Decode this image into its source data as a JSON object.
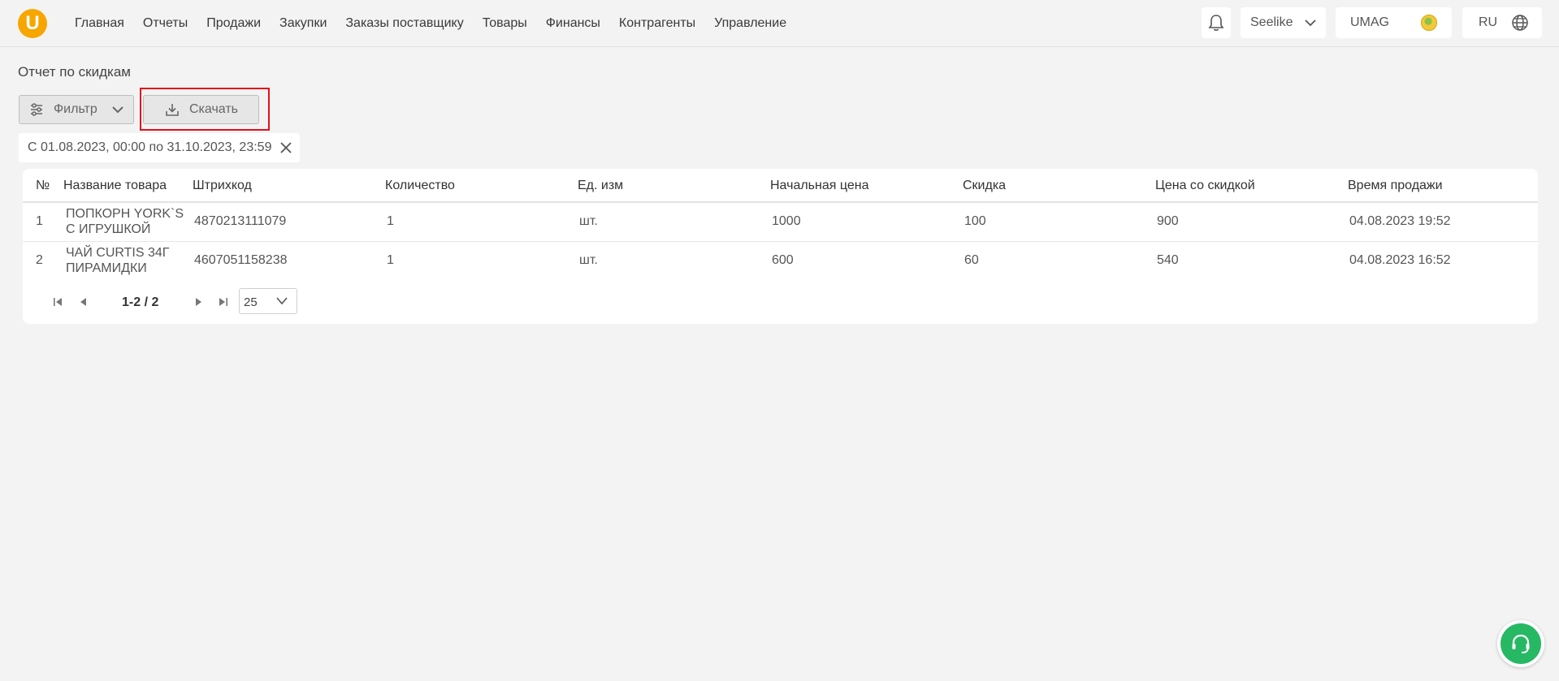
{
  "header": {
    "logo_letter": "U",
    "nav": [
      "Главная",
      "Отчеты",
      "Продажи",
      "Закупки",
      "Заказы поставщику",
      "Товары",
      "Финансы",
      "Контрагенты",
      "Управление"
    ],
    "account": "Seelike",
    "store": "UMAG",
    "language": "RU"
  },
  "page": {
    "title": "Отчет по скидкам",
    "filter_label": "Фильтр",
    "download_label": "Скачать",
    "date_chip": "С 01.08.2023, 00:00 по 31.10.2023, 23:59"
  },
  "table": {
    "columns": [
      "№",
      "Название товара",
      "Штрихкод",
      "Количество",
      "Ед. изм",
      "Начальная цена",
      "Скидка",
      "Цена со скидкой",
      "Время продажи"
    ],
    "rows": [
      {
        "num": "1",
        "name_line1": "ПОПКОРН YORK`S",
        "name_line2": "С ИГРУШКОЙ",
        "barcode": "4870213111079",
        "qty": "1",
        "unit": "шт.",
        "start_price": "1000",
        "discount": "100",
        "final_price": "900",
        "time": "04.08.2023 19:52"
      },
      {
        "num": "2",
        "name_line1": "ЧАЙ CURTIS 34Г",
        "name_line2": "ПИРАМИДКИ",
        "barcode": "4607051158238",
        "qty": "1",
        "unit": "шт.",
        "start_price": "600",
        "discount": "60",
        "final_price": "540",
        "time": "04.08.2023 16:52"
      }
    ]
  },
  "pagination": {
    "range": "1-2 / 2",
    "per_page": "25"
  },
  "icons": {
    "bell": "bell-icon",
    "globe": "globe-icon",
    "support": "headset-icon"
  },
  "colors": {
    "brand": "#f7a600",
    "highlight": "#e0111b",
    "support": "#27b864"
  }
}
